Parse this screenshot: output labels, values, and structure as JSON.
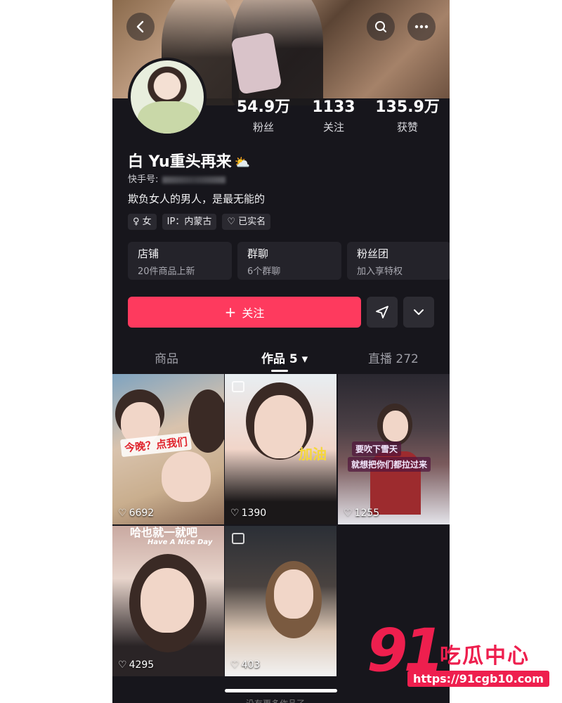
{
  "header": {
    "back_icon": "chevron-left-icon",
    "search_icon": "search-icon",
    "more_icon": "more-horizontal-icon"
  },
  "profile": {
    "name": "白 Yu重头再来",
    "kuaishou_id_label": "快手号:",
    "bio": "欺负女人的男人，是最无能的",
    "tags": [
      "♀ 女",
      "IP：内蒙古",
      "♡ 已实名"
    ]
  },
  "stats": [
    {
      "value": "54.9万",
      "label": "粉丝"
    },
    {
      "value": "1133",
      "label": "关注"
    },
    {
      "value": "135.9万",
      "label": "获赞"
    }
  ],
  "services": [
    {
      "title": "店铺",
      "subtitle": "20件商品上新"
    },
    {
      "title": "群聊",
      "subtitle": "6个群聊"
    },
    {
      "title": "粉丝团",
      "subtitle": "加入享特权"
    }
  ],
  "actions": {
    "follow_label": "关注",
    "follow_icon": "plus-icon",
    "share_icon": "send-icon",
    "dropdown_icon": "chevron-down-icon"
  },
  "tabs": {
    "goods": "商品",
    "works": "作品 5 ▾",
    "live": "直播 272"
  },
  "videos": [
    {
      "likes": "6692",
      "caption": "今晚？点我们"
    },
    {
      "likes": "1390",
      "caption": "加油"
    },
    {
      "likes": "1255",
      "caption": "要吹下雪天",
      "caption2": "就想把你们都拉过来"
    },
    {
      "likes": "4295",
      "caption": "哈也就一就吧",
      "caption2": "Have A Nice Day"
    },
    {
      "likes": "403"
    }
  ],
  "footer": {
    "text": "没有更多作品了"
  },
  "watermark": {
    "number": "91",
    "title": "吃瓜中心",
    "url": "https://91cgb10.com"
  },
  "colors": {
    "accent": "#fe3a5e",
    "background": "#17161c",
    "watermark": "#ee1f4e"
  }
}
